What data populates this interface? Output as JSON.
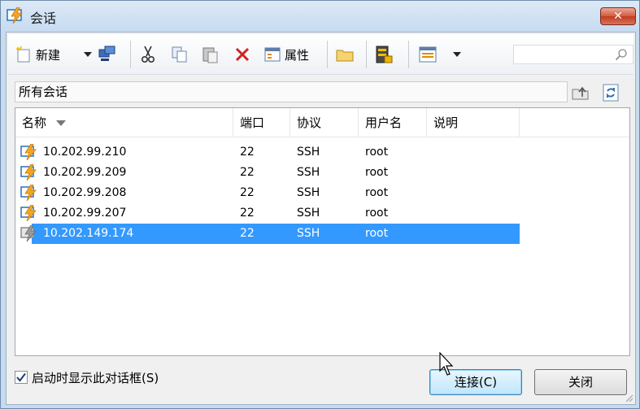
{
  "window": {
    "title": "会话",
    "close_label": "✕"
  },
  "toolbar": {
    "new_label": "新建",
    "properties_label": "属性",
    "search_placeholder": ""
  },
  "path": {
    "label": "所有会话"
  },
  "list": {
    "columns": [
      "名称",
      "端口",
      "协议",
      "用户名",
      "说明"
    ],
    "rows": [
      {
        "name": "10.202.99.210",
        "port": "22",
        "protocol": "SSH",
        "user": "root",
        "desc": ""
      },
      {
        "name": "10.202.99.209",
        "port": "22",
        "protocol": "SSH",
        "user": "root",
        "desc": ""
      },
      {
        "name": "10.202.99.208",
        "port": "22",
        "protocol": "SSH",
        "user": "root",
        "desc": ""
      },
      {
        "name": "10.202.99.207",
        "port": "22",
        "protocol": "SSH",
        "user": "root",
        "desc": ""
      },
      {
        "name": "10.202.149.174",
        "port": "22",
        "protocol": "SSH",
        "user": "root",
        "desc": ""
      }
    ],
    "selected_index": 4
  },
  "footer": {
    "startup_checkbox_label": "启动时显示此对话框(S)",
    "startup_checked": true,
    "connect_label": "连接(C)",
    "close_label": "关闭"
  },
  "colors": {
    "selection": "#3399ff",
    "accent_orange": "#f5a623",
    "icon_blue": "#2f6fb8"
  }
}
